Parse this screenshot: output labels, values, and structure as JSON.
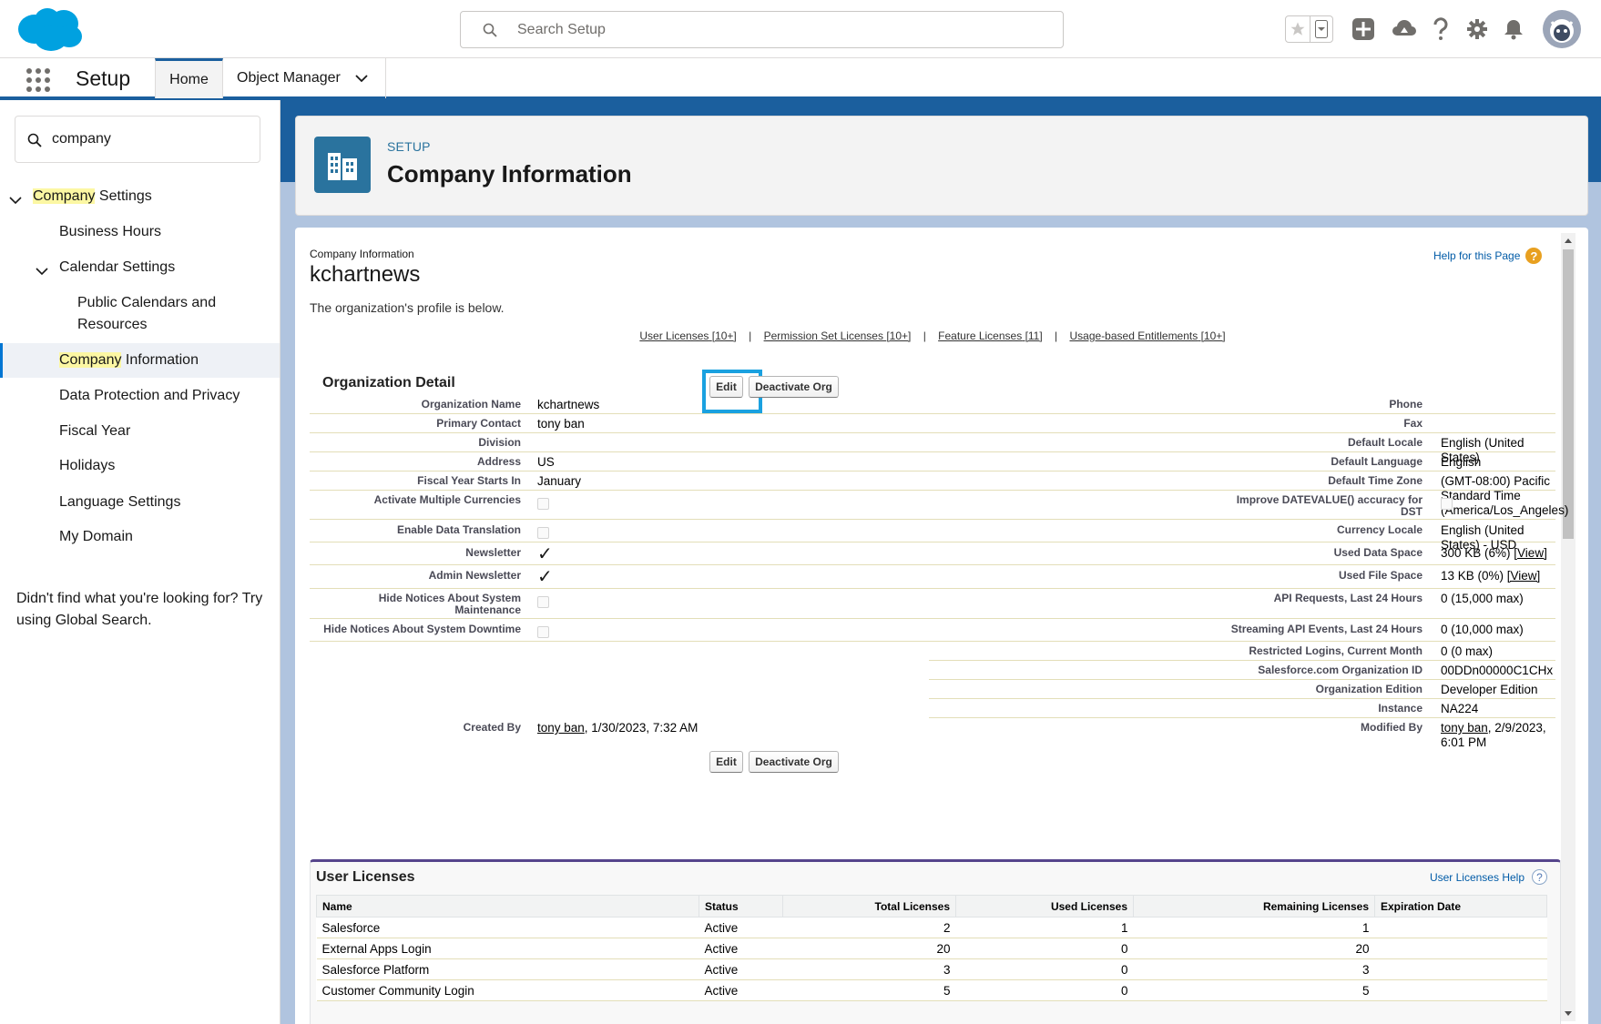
{
  "header": {
    "search_placeholder": "Search Setup",
    "brand_color": "#00a1e0"
  },
  "nav": {
    "app_name": "Setup",
    "tabs": [
      {
        "label": "Home"
      },
      {
        "label": "Object Manager"
      }
    ]
  },
  "sidebar": {
    "quick_find_value": "company",
    "company_settings": {
      "hl": "Company",
      "rest": " Settings"
    },
    "business_hours": "Business Hours",
    "calendar_settings": "Calendar Settings",
    "public_calendars": "Public Calendars and Resources",
    "company_information": {
      "hl": "Company",
      "rest": " Information"
    },
    "data_protection": "Data Protection and Privacy",
    "fiscal_year": "Fiscal Year",
    "holidays": "Holidays",
    "language_settings": "Language Settings",
    "my_domain": "My Domain",
    "help_text": "Didn't find what you're looking for? Try using Global Search."
  },
  "page_header": {
    "eyebrow": "SETUP",
    "title": "Company Information"
  },
  "content": {
    "breadcrumb": "Company Information",
    "org_heading": "kchartnews",
    "help_link": "Help for this Page",
    "description": "The organization's profile is below.",
    "related_links": [
      {
        "label": "User Licenses",
        "count": "[10+]"
      },
      {
        "label": "Permission Set Licenses",
        "count": "[10+]"
      },
      {
        "label": "Feature Licenses",
        "count": "[11]"
      },
      {
        "label": "Usage-based Entitlements",
        "count": "[10+]"
      }
    ],
    "link_separator": "|",
    "section_title": "Organization Detail",
    "edit_label": "Edit",
    "deactivate_label": "Deactivate Org"
  },
  "detail": {
    "org_name": {
      "label": "Organization Name",
      "value": "kchartnews"
    },
    "primary_contact": {
      "label": "Primary Contact",
      "value": "tony ban"
    },
    "division": {
      "label": "Division",
      "value": ""
    },
    "address": {
      "label": "Address",
      "value": "US"
    },
    "fiscal_year": {
      "label": "Fiscal Year Starts In",
      "value": "January"
    },
    "multi_currency": {
      "label": "Activate Multiple Currencies",
      "checked": false
    },
    "data_translation": {
      "label": "Enable Data Translation",
      "checked": false
    },
    "newsletter": {
      "label": "Newsletter",
      "checked": true
    },
    "admin_newsletter": {
      "label": "Admin Newsletter",
      "checked": true
    },
    "hide_maintenance": {
      "label": "Hide Notices About System Maintenance",
      "checked": false
    },
    "hide_downtime": {
      "label": "Hide Notices About System Downtime",
      "checked": false
    },
    "created_by": {
      "label": "Created By",
      "user": "tony ban",
      "date": ", 1/30/2023, 7:32 AM"
    },
    "phone": {
      "label": "Phone",
      "value": ""
    },
    "fax": {
      "label": "Fax",
      "value": ""
    },
    "default_locale": {
      "label": "Default Locale",
      "value": "English (United States)"
    },
    "default_language": {
      "label": "Default Language",
      "value": "English"
    },
    "default_tz": {
      "label": "Default Time Zone",
      "value": "(GMT-08:00) Pacific Standard Time (America/Los_Angeles)"
    },
    "datevalue": {
      "label": "Improve DATEVALUE() accuracy for DST",
      "checked": false
    },
    "currency_locale": {
      "label": "Currency Locale",
      "value": "English (United States) - USD"
    },
    "used_data": {
      "label": "Used Data Space",
      "value": "300 KB (6%) ",
      "link": "[View]"
    },
    "used_file": {
      "label": "Used File Space",
      "value": "13 KB (0%) ",
      "link": "[View]"
    },
    "api_requests": {
      "label": "API Requests, Last 24 Hours",
      "value": "0 (15,000 max)"
    },
    "streaming": {
      "label": "Streaming API Events, Last 24 Hours",
      "value": "0 (10,000 max)"
    },
    "restricted": {
      "label": "Restricted Logins, Current Month",
      "value": "0 (0 max)"
    },
    "org_id": {
      "label": "Salesforce.com Organization ID",
      "value": "00DDn00000C1CHx"
    },
    "edition": {
      "label": "Organization Edition",
      "value": "Developer Edition"
    },
    "instance": {
      "label": "Instance",
      "value": "NA224"
    },
    "modified_by": {
      "label": "Modified By",
      "user": "tony ban",
      "date": ", 2/9/2023, 6:01 PM"
    }
  },
  "user_licenses": {
    "title": "User Licenses",
    "help": "User Licenses Help",
    "columns": [
      "Name",
      "Status",
      "Total Licenses",
      "Used Licenses",
      "Remaining Licenses",
      "Expiration Date"
    ],
    "rows": [
      [
        "Salesforce",
        "Active",
        "2",
        "1",
        "1",
        ""
      ],
      [
        "External Apps Login",
        "Active",
        "20",
        "0",
        "20",
        ""
      ],
      [
        "Salesforce Platform",
        "Active",
        "3",
        "0",
        "3",
        ""
      ],
      [
        "Customer Community Login",
        "Active",
        "5",
        "0",
        "5",
        ""
      ]
    ]
  }
}
